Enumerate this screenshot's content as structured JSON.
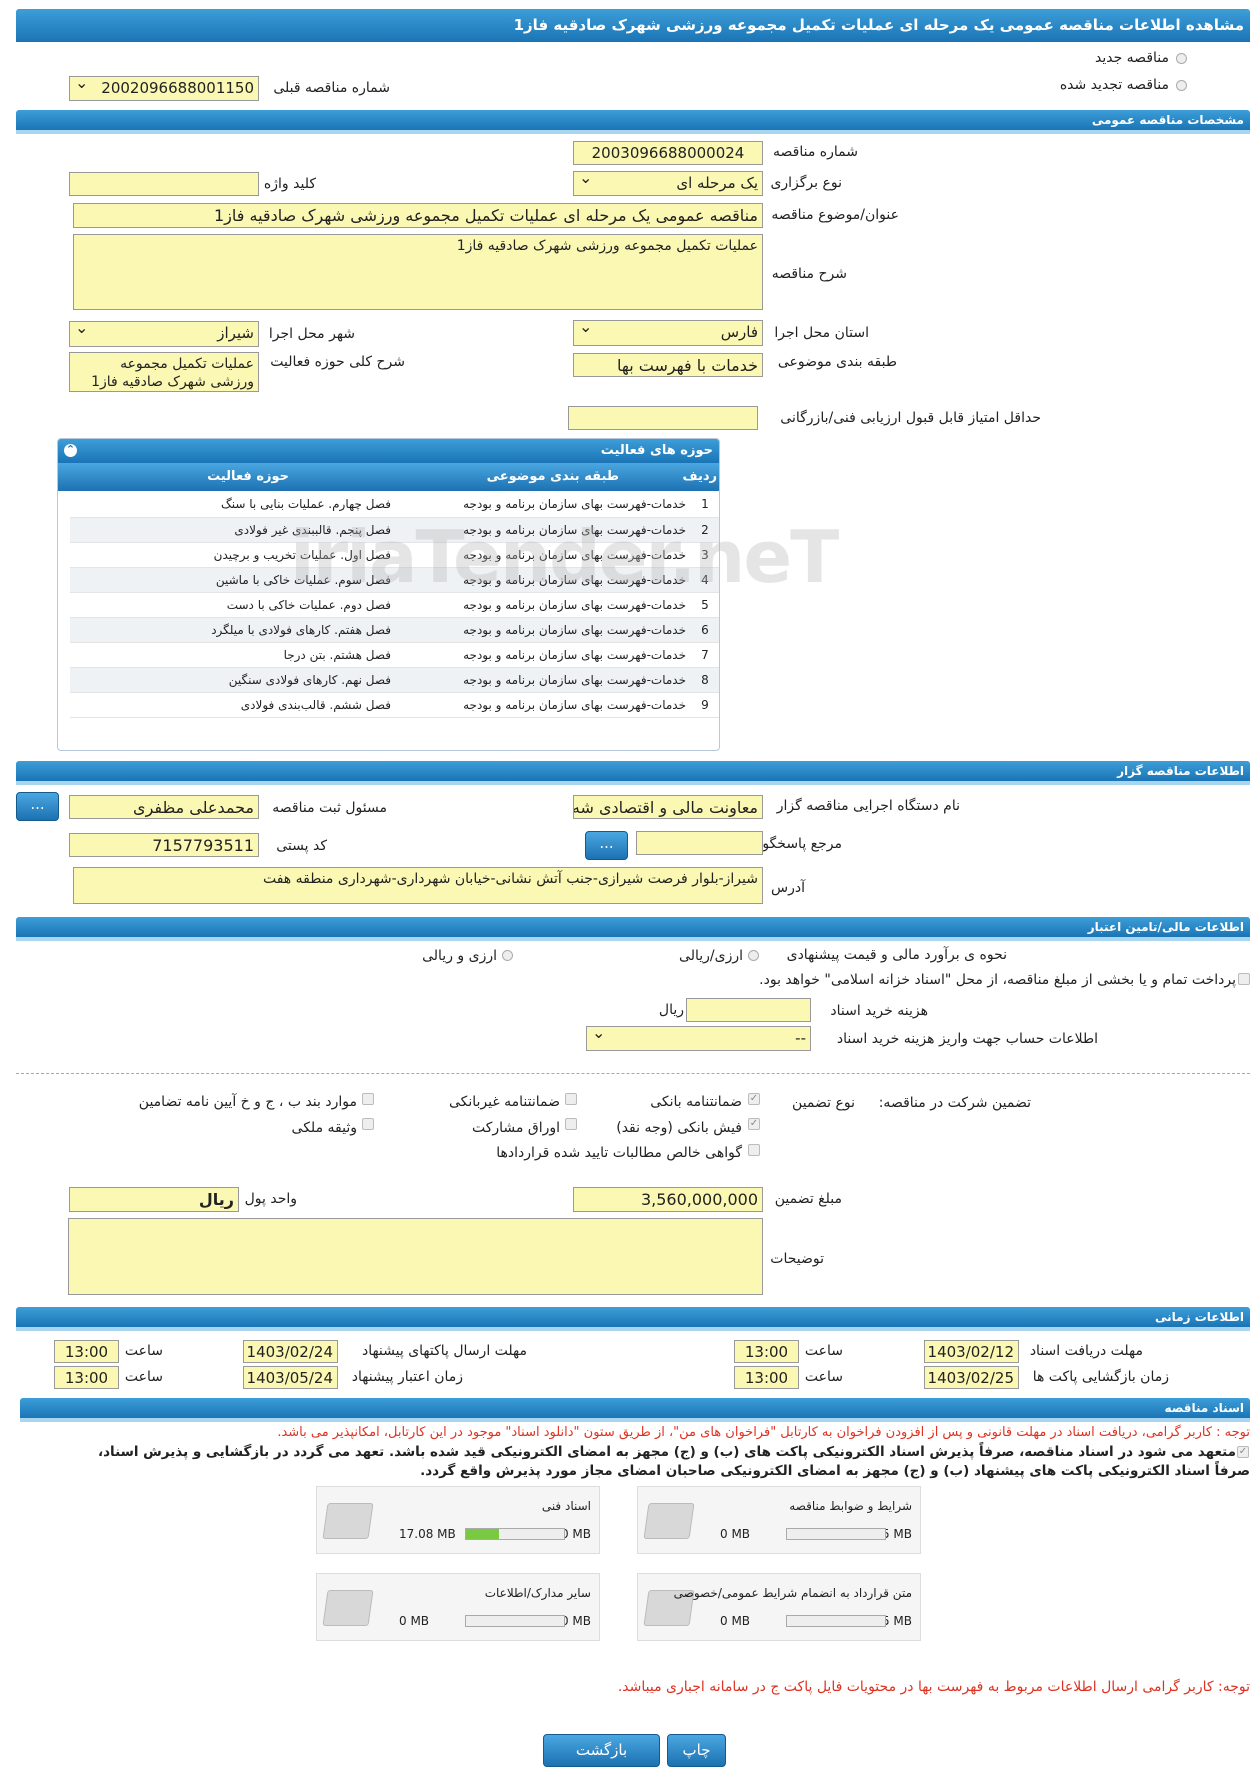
{
  "title": "مشاهده اطلاعات مناقصه عمومی یک مرحله ای عملیات تکمیل مجموعه ورزشی شهرک صادقیه فاز1",
  "top": {
    "new_tender": "مناقصه جدید",
    "renewed_tender": "مناقصه تجدید شده",
    "prev_number_label": "شماره مناقصه قبلی",
    "prev_number": "2002096688001150"
  },
  "general": {
    "header": "مشخصات مناقصه عمومی",
    "number_label": "شماره مناقصه",
    "number": "2003096688000024",
    "type_label": "نوع برگزاری",
    "type": "یک مرحله ای",
    "keyword_label": "کلید واژه",
    "keyword": "",
    "subject_label": "عنوان/موضوع مناقصه",
    "subject": "مناقصه عمومی یک مرحله ای عملیات تکمیل مجموعه ورزشی شهرک صادقیه فاز1",
    "desc_label": "شرح مناقصه",
    "desc": "عملیات تکمیل مجموعه ورزشی شهرک صادقیه فاز1",
    "province_label": "استان محل اجرا",
    "province": "فارس",
    "city_label": "شهر محل اجرا",
    "city": "شیراز",
    "category_label": "طبقه بندی موضوعی",
    "category": "خدمات با فهرست بها",
    "scope_label": "شرح کلی حوزه فعالیت",
    "scope": "عملیات تکمیل مجموعه ورزشی شهرک صادقیه فاز1",
    "min_score_label": "حداقل امتیاز قابل قبول ارزیابی فنی/بازرگانی",
    "min_score": ""
  },
  "activities": {
    "header": "حوزه های فعالیت",
    "col_row": "ردیف",
    "col_category": "طبقه بندی موضوعی",
    "col_activity": "حوزه فعالیت",
    "rows": [
      {
        "n": "1",
        "cat": "خدمات-فهرست بهای سازمان برنامه و بودجه",
        "act": "فصل چهارم. عملیات بنایی با سنگ"
      },
      {
        "n": "2",
        "cat": "خدمات-فهرست بهای سازمان برنامه و بودجه",
        "act": "فصل پنجم. قالببندی غیر فولادی"
      },
      {
        "n": "3",
        "cat": "خدمات-فهرست بهای سازمان برنامه و بودجه",
        "act": "فصل اول. عملیات تخریب و برچیدن"
      },
      {
        "n": "4",
        "cat": "خدمات-فهرست بهای سازمان برنامه و بودجه",
        "act": "فصل سوم. عملیات خاکی با ماشین"
      },
      {
        "n": "5",
        "cat": "خدمات-فهرست بهای سازمان برنامه و بودجه",
        "act": "فصل دوم. عملیات خاکی با دست"
      },
      {
        "n": "6",
        "cat": "خدمات-فهرست بهای سازمان برنامه و بودجه",
        "act": "فصل هفتم. کارهای فولادی با میلگرد"
      },
      {
        "n": "7",
        "cat": "خدمات-فهرست بهای سازمان برنامه و بودجه",
        "act": "فصل هشتم. بتن درجا"
      },
      {
        "n": "8",
        "cat": "خدمات-فهرست بهای سازمان برنامه و بودجه",
        "act": "فصل نهم. کارهای فولادی سنگین"
      },
      {
        "n": "9",
        "cat": "خدمات-فهرست بهای سازمان برنامه و بودجه",
        "act": "فصل ششم. قالب‌بندی فولادی"
      }
    ]
  },
  "organizer": {
    "header": "اطلاعات مناقصه گزار",
    "org_label": "نام دستگاه اجرایی مناقصه گزار",
    "org": "معاونت مالی و اقتصادی شه",
    "registrar_label": "مسئول ثبت مناقصه",
    "registrar": "محمدعلی مظفری",
    "ref_label": "مرجع پاسخگویی",
    "ref": "",
    "postal_label": "کد پستی",
    "postal": "7157793511",
    "address_label": "آدرس",
    "address": "شیراز-بلوار فرصت شیرازی-جنب آتش نشانی-خیابان شهرداری-شهرداری منطقه هفت",
    "more_btn": "..."
  },
  "financial": {
    "header": "اطلاعات مالی/تامین اعتبار",
    "method_label": "نحوه ی برآورد مالی و قیمت پیشنهادی",
    "opt_rial": "ارزی/ریالی",
    "opt_fx": "ارزی و ریالی",
    "treasury_text": "پرداخت تمام و یا بخشی از مبلغ مناقصه، از محل \"اسناد خزانه اسلامی\" خواهد بود.",
    "doc_fee_label": "هزینه خرید اسناد",
    "doc_fee_unit": "ریال",
    "account_label": "اطلاعات حساب جهت واریز هزینه خرید اسناد",
    "account": "--",
    "guarantee_label": "تضمین شرکت در مناقصه:",
    "guarantee_type_label": "نوع تضمین",
    "g_bank": "ضمانتنامه بانکی",
    "g_nonbank": "ضمانتنامه غیربانکی",
    "g_bylaw": "موارد بند ب ، ج و خ آیین نامه تضامین",
    "g_cheque": "فیش بانکی (وجه نقد)",
    "g_bonds": "اوراق مشارکت",
    "g_property": "وثیقه ملکی",
    "g_claims": "گواهی خالص مطالبات تایید شده قراردادها",
    "amount_label": "مبلغ تضمین",
    "amount": "3,560,000,000",
    "currency_label": "واحد پول",
    "currency": "ریال",
    "notes_label": "توضیحات",
    "notes": ""
  },
  "timing": {
    "header": "اطلاعات زمانی",
    "doc_receive_label": "مهلت دریافت اسناد",
    "doc_receive_date": "1403/02/12",
    "doc_receive_time": "13:00",
    "submit_label": "مهلت ارسال پاکتهای پیشنهاد",
    "submit_date": "1403/02/24",
    "submit_time": "13:00",
    "open_label": "زمان بازگشایی پاکت ها",
    "open_date": "1403/02/25",
    "open_time": "13:00",
    "validity_label": "زمان اعتبار پیشنهاد",
    "validity_date": "1403/05/24",
    "validity_time": "13:00",
    "time_label": "ساعت"
  },
  "documents": {
    "header": "اسناد مناقصه",
    "note1": "توجه : کاربر گرامی، دریافت اسناد در مهلت قانونی و پس از افزودن فراخوان به کارتابل \"فراخوان های من\"، از طریق ستون \"دانلود اسناد\" موجود در این کارتابل، امکانپذیر می باشد.",
    "commit_line1": "متعهد می شود در اسناد مناقصه، صرفاً پذیرش اسناد الکترونیکی پاکت های (ب) و (ج) مجهز به امضای الکترونیکی قید شده باشد. تعهد می گردد در بازگشایی و پذیرش اسناد،",
    "commit_line2": "صرفاً اسناد الکترونیکی پاکت های پیشنهاد (ب) و (ج) مجهز به امضای الکترونیکی صاحبان امضای مجاز مورد پذیرش واقع گردد.",
    "files": [
      {
        "name": "شرایط و ضوابط مناقصه",
        "size": "0 MB",
        "max": "5 MB",
        "fill": 0
      },
      {
        "name": "اسناد فنی",
        "size": "17.08 MB",
        "max": "50 MB",
        "fill": 0.34
      },
      {
        "name": "متن قرارداد به انضمام شرایط عمومی/خصوصی",
        "size": "0 MB",
        "max": "5 MB",
        "fill": 0
      },
      {
        "name": "سایر مدارک/اطلاعات",
        "size": "0 MB",
        "max": "50 MB",
        "fill": 0
      }
    ],
    "note2": "توجه: کاربر گرامی ارسال اطلاعات مربوط به فهرست بها در محتویات فایل پاکت ج در سامانه اجباری میباشد."
  },
  "buttons": {
    "print": "چاپ",
    "back": "بازگشت"
  }
}
